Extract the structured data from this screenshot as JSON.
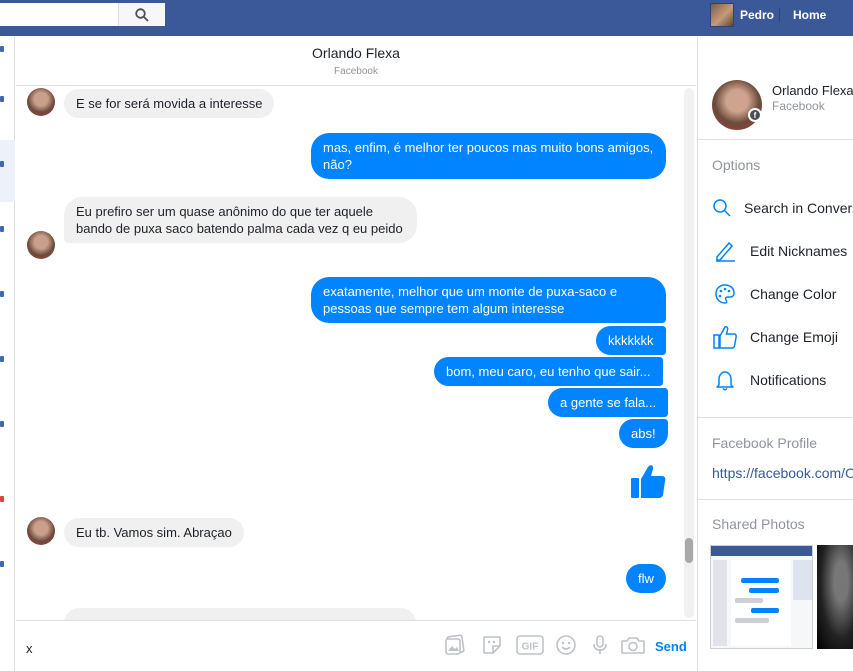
{
  "topbar": {
    "user_name": "Pedro",
    "home_label": "Home",
    "search_icon": "search-icon"
  },
  "conversation": {
    "name": "Orlando Flexa",
    "subtitle": "Facebook",
    "messages": [
      {
        "dir": "in",
        "text": "E se for será movida a interesse"
      },
      {
        "dir": "out",
        "text": "mas, enfim, é melhor ter poucos mas muito bons amigos, não?"
      },
      {
        "dir": "in",
        "text": "Eu prefiro ser um quase anônimo do que ter aquele bando de puxa saco batendo palma cada vez q eu peido"
      },
      {
        "dir": "out",
        "text": "exatamente, melhor que um monte de puxa-saco e pessoas que sempre tem algum interesse"
      },
      {
        "dir": "out",
        "text": "kkkkkkk"
      },
      {
        "dir": "out",
        "text": "bom, meu caro, eu tenho que sair..."
      },
      {
        "dir": "out",
        "text": "a gente se fala..."
      },
      {
        "dir": "out",
        "text": "abs!"
      },
      {
        "dir": "out",
        "type": "like",
        "icon": "thumbs-up-icon"
      },
      {
        "dir": "in",
        "text": "Eu tb. Vamos sim. Abraçao"
      },
      {
        "dir": "out",
        "text": "flw"
      }
    ]
  },
  "composer": {
    "input_value": "x",
    "send_label": "Send",
    "icons": [
      "photo-icon",
      "sticker-icon",
      "gif-icon",
      "emoji-icon",
      "microphone-icon",
      "camera-icon"
    ]
  },
  "right_panel": {
    "name": "Orlando Flexa",
    "subtitle": "Facebook",
    "options_heading": "Options",
    "options": [
      {
        "label": "Search in Conversation",
        "icon": "search-icon"
      },
      {
        "label": "Edit Nicknames",
        "icon": "pencil-icon"
      },
      {
        "label": "Change Color",
        "icon": "palette-icon"
      },
      {
        "label": "Change Emoji",
        "icon": "thumbs-up-icon"
      },
      {
        "label": "Notifications",
        "icon": "bell-icon"
      }
    ],
    "profile_heading": "Facebook Profile",
    "profile_link": "https://facebook.com/O",
    "photos_heading": "Shared Photos"
  },
  "colors": {
    "brand": "#3b5998",
    "outgoing": "#0084ff",
    "incoming": "#f1f0f0"
  }
}
